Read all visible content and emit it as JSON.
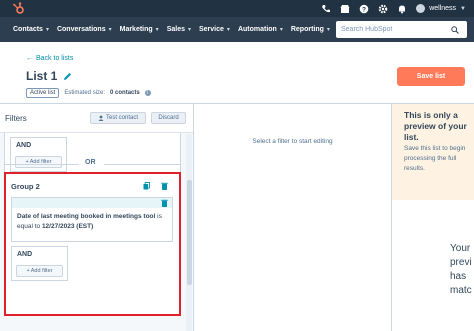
{
  "topbar": {
    "account_name": "wellness"
  },
  "nav": {
    "items": [
      {
        "label": "Contacts"
      },
      {
        "label": "Conversations"
      },
      {
        "label": "Marketing"
      },
      {
        "label": "Sales"
      },
      {
        "label": "Service"
      },
      {
        "label": "Automation"
      },
      {
        "label": "Reporting"
      }
    ],
    "search_placeholder": "Search HubSpot"
  },
  "header": {
    "back_label": "Back to lists",
    "title": "List 1",
    "save_label": "Save list",
    "badge": "Active list",
    "estimate_label": "Estimated size:",
    "estimate_value": "0 contacts"
  },
  "filters": {
    "title": "Filters",
    "test_contact_label": "Test contact",
    "discard_label": "Discard",
    "group1": {
      "and_label": "AND",
      "add_filter_label": "Add filter"
    },
    "or_label": "OR",
    "group2": {
      "title": "Group 2",
      "filter_property": "Date of last meeting booked in meetings tool",
      "filter_operator": " is equal to ",
      "filter_value": "12/27/2023 (EST)",
      "and_label": "AND",
      "add_filter_label": "Add filter"
    }
  },
  "center": {
    "message": "Select a filter to start editing"
  },
  "preview": {
    "title": "This is only a preview of your list.",
    "body": "Save this list to begin processing the full results.",
    "partial_lines": [
      "Your",
      "previ",
      "has",
      "matc"
    ]
  },
  "colors": {
    "topbar": "#213343",
    "navbar": "#2d3e50",
    "accent": "#ff7a59",
    "link": "#0091ae",
    "highlight": "#e0202b"
  }
}
